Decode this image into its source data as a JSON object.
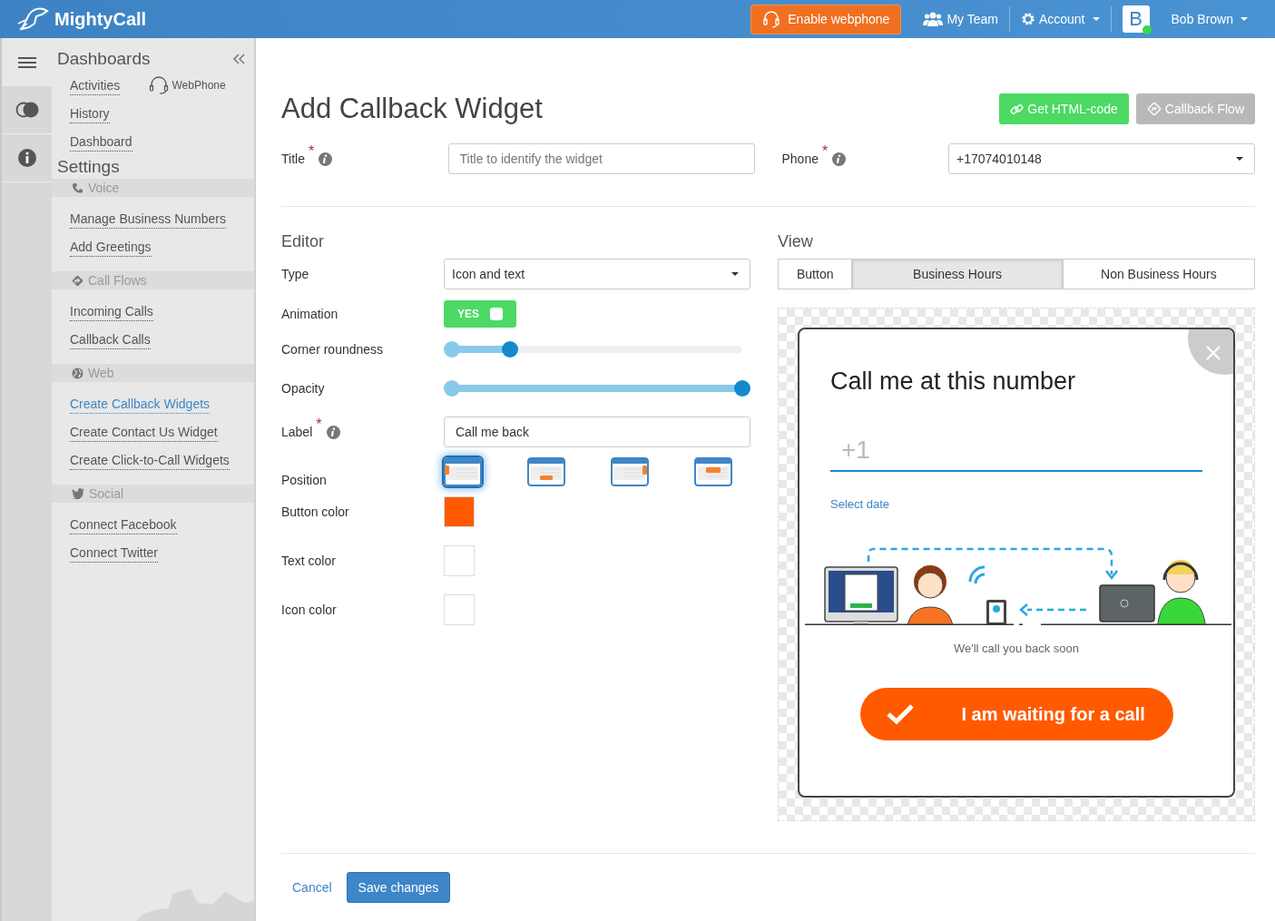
{
  "header": {
    "logo_text": "MightyCall",
    "webphone_button": "Enable webphone",
    "nav": [
      {
        "kind": "team",
        "label": "My Team",
        "dropdown": false
      },
      {
        "kind": "account",
        "label": "Account",
        "dropdown": true
      }
    ],
    "user": {
      "avatar_letter": "B",
      "online": true,
      "name": "Bob Brown"
    }
  },
  "sidebar": {
    "title": "Dashboards",
    "dashboard_links": [
      {
        "label": "Activities",
        "selected": false
      },
      {
        "label": "History",
        "selected": false
      },
      {
        "label": "Dashboard",
        "selected": false
      }
    ],
    "webphone_label": "WebPhone",
    "settings_title": "Settings",
    "sections": [
      {
        "kind": "voice",
        "title": "Voice",
        "items": [
          {
            "label": "Manage Business Numbers",
            "selected": false
          },
          {
            "label": "Add Greetings",
            "selected": false
          }
        ]
      },
      {
        "kind": "flows",
        "title": "Call Flows",
        "items": [
          {
            "label": "Incoming Calls",
            "selected": false
          },
          {
            "label": "Callback Calls",
            "selected": false
          }
        ]
      },
      {
        "kind": "web",
        "title": "Web",
        "items": [
          {
            "label": "Create Callback Widgets",
            "selected": true
          },
          {
            "label": "Create Contact Us Widget",
            "selected": false
          },
          {
            "label": "Create Click-to-Call Widgets",
            "selected": false
          }
        ]
      },
      {
        "kind": "social",
        "title": "Social",
        "items": [
          {
            "label": "Connect Facebook",
            "selected": false
          },
          {
            "label": "Connect Twitter",
            "selected": false
          }
        ]
      }
    ]
  },
  "page": {
    "title": "Add Callback Widget",
    "buttons": [
      {
        "kind": "html",
        "label": "Get HTML-code",
        "disabled": false
      },
      {
        "kind": "flow",
        "label": "Callback Flow",
        "disabled": true
      }
    ],
    "title_field": {
      "label": "Title",
      "required_mark": "*",
      "placeholder": "Title to identify the widget"
    },
    "phone_field": {
      "label": "Phone",
      "required_mark": "*",
      "value": "+17074010148"
    }
  },
  "editor": {
    "heading": "Editor",
    "type": {
      "label": "Type",
      "value": "Icon and text"
    },
    "animation": {
      "label": "Animation",
      "on": true,
      "text": "YES"
    },
    "sliders": [
      {
        "label": "Corner roundness",
        "level": 0.2
      },
      {
        "label": "Opacity",
        "level": 1
      }
    ],
    "label_field": {
      "label": "Label",
      "required_mark": "*",
      "value": "Call me back"
    },
    "position": {
      "label": "Position",
      "options": [
        {
          "kind": "left",
          "selected": true
        },
        {
          "kind": "bottom",
          "selected": false
        },
        {
          "kind": "right",
          "selected": false
        },
        {
          "kind": "center",
          "selected": false
        }
      ]
    },
    "colors": [
      {
        "label": "Button color",
        "color": "#ff5a00"
      },
      {
        "label": "Text color",
        "color": "#ffffff"
      },
      {
        "label": "Icon color",
        "color": "#ffffff"
      }
    ]
  },
  "view": {
    "heading": "View",
    "tabs": [
      {
        "label": "Button",
        "selected": false
      },
      {
        "label": "Business Hours",
        "selected": true
      },
      {
        "label": "Non Business Hours",
        "selected": false
      }
    ],
    "preview": {
      "title": "Call me at this number",
      "phone_placeholder": "+1",
      "select_date": "Select date",
      "caption": "We'll call you back soon",
      "button": "I am waiting for a call"
    }
  },
  "footer": {
    "cancel": "Cancel",
    "save": "Save changes"
  }
}
